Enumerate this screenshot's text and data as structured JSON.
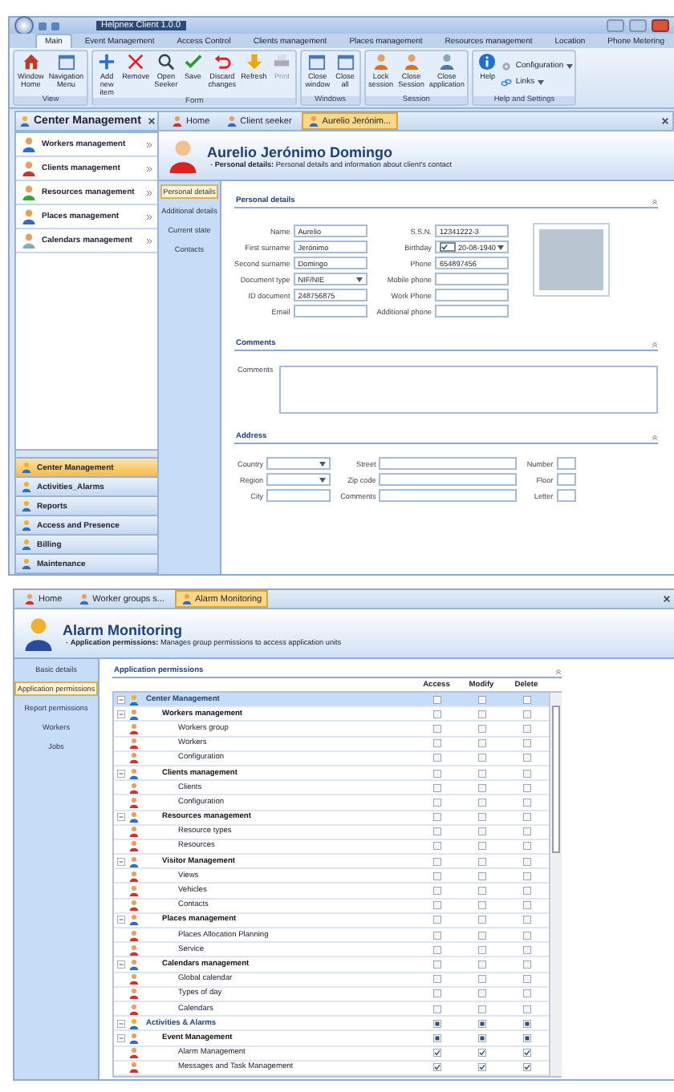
{
  "window": {
    "title": "Helpnex Client 1.0.0"
  },
  "menu_tabs": [
    {
      "label": "Main",
      "selected": true
    },
    {
      "label": "Event Management",
      "selected": false
    },
    {
      "label": "Access Control",
      "selected": false
    },
    {
      "label": "Clients management",
      "selected": false
    },
    {
      "label": "Places management",
      "selected": false
    },
    {
      "label": "Resources management",
      "selected": false
    },
    {
      "label": "Location",
      "selected": false
    },
    {
      "label": "Phone Metering",
      "selected": false
    }
  ],
  "ribbon": [
    {
      "group": "View",
      "buttons": [
        {
          "label": "Window Home",
          "kind": "large",
          "disabled": false
        },
        {
          "label": "Navigation Menu",
          "kind": "large",
          "disabled": false
        }
      ]
    },
    {
      "group": "Form",
      "buttons": [
        {
          "label": "Add new item",
          "kind": "large",
          "disabled": false
        },
        {
          "label": "Remove",
          "kind": "large",
          "disabled": false
        },
        {
          "label": "Open Seeker",
          "kind": "large",
          "disabled": false
        },
        {
          "label": "Save",
          "kind": "large",
          "disabled": false
        },
        {
          "label": "Discard changes",
          "kind": "large",
          "disabled": false
        },
        {
          "label": "Refresh",
          "kind": "large",
          "disabled": false
        },
        {
          "label": "Print",
          "kind": "large",
          "disabled": true
        }
      ]
    },
    {
      "group": "Windows",
      "buttons": [
        {
          "label": "Close window",
          "kind": "large",
          "disabled": false
        },
        {
          "label": "Close all",
          "kind": "large",
          "disabled": false
        }
      ]
    },
    {
      "group": "Session",
      "buttons": [
        {
          "label": "Lock session",
          "kind": "large",
          "disabled": false
        },
        {
          "label": "Close Session",
          "kind": "large",
          "disabled": false
        },
        {
          "label": "Close application",
          "kind": "large",
          "disabled": false
        }
      ]
    },
    {
      "group": "Help and Settings",
      "buttons": [
        {
          "label": "Help",
          "kind": "large",
          "disabled": false
        },
        {
          "label": "Configuration",
          "kind": "small",
          "disabled": false
        },
        {
          "label": "Links",
          "kind": "small",
          "disabled": false
        }
      ]
    }
  ],
  "sidebar": {
    "title": "Center Management",
    "modules": [
      "Workers management",
      "Clients management",
      "Resources management",
      "Places management",
      "Calendars management"
    ],
    "sections": [
      {
        "label": "Center Management",
        "selected": true
      },
      {
        "label": "Activities_Alarms",
        "selected": false
      },
      {
        "label": "Reports",
        "selected": false
      },
      {
        "label": "Access and Presence",
        "selected": false
      },
      {
        "label": "Billing",
        "selected": false
      },
      {
        "label": "Maintenance",
        "selected": false
      }
    ]
  },
  "documents": [
    {
      "label": "Home",
      "selected": false
    },
    {
      "label": "Client seeker",
      "selected": false
    },
    {
      "label": "Aurelio Jerónim...",
      "selected": true
    }
  ],
  "client": {
    "name": "Aurelio Jerónimo Domingo",
    "subtitle": "- **Personal details:** Personal details and information about client's contact",
    "side_tabs": [
      {
        "label": "Personal details",
        "selected": true
      },
      {
        "label": "Additional details",
        "selected": false
      },
      {
        "label": "Current state",
        "selected": false
      },
      {
        "label": "Contacts",
        "selected": false
      }
    ],
    "personal": {
      "title": "Personal details",
      "left": [
        {
          "label": "Name",
          "value": "Aurelio",
          "kind": "text"
        },
        {
          "label": "First surname",
          "value": "Jerónimo",
          "kind": "text"
        },
        {
          "label": "Second surname",
          "value": "Domingo",
          "kind": "text"
        },
        {
          "label": "Document type",
          "value": "NIF/NIE",
          "kind": "select"
        },
        {
          "label": "ID document",
          "value": "248756875",
          "kind": "text"
        },
        {
          "label": "Email",
          "kind": "text"
        }
      ],
      "right": [
        {
          "label": "S.S.N.",
          "value": "12341222-3",
          "kind": "text"
        },
        {
          "label": "Birthday",
          "value": "20-08-1940",
          "kind": "date",
          "checked": true
        },
        {
          "label": "Phone",
          "value": "654897456",
          "kind": "text"
        },
        {
          "label": "Mobile phone",
          "kind": "text"
        },
        {
          "label": "Work Phone",
          "kind": "text"
        },
        {
          "label": "Additional phone",
          "kind": "text"
        }
      ]
    },
    "comments": {
      "title": "Comments",
      "label": "Comments"
    },
    "address": {
      "title": "Address",
      "columns": [
        [
          {
            "label": "Country",
            "kind": "select"
          },
          {
            "label": "Region",
            "kind": "select"
          },
          {
            "label": "City",
            "kind": "text"
          }
        ],
        [
          {
            "label": "Street",
            "kind": "text"
          },
          {
            "label": "Zip code",
            "kind": "text"
          },
          {
            "label": "Comments",
            "kind": "text"
          }
        ],
        [
          {
            "label": "Number",
            "kind": "text"
          },
          {
            "label": "Floor",
            "kind": "text"
          },
          {
            "label": "Letter",
            "kind": "text"
          }
        ]
      ]
    }
  },
  "alarm": {
    "documents": [
      {
        "label": "Home",
        "selected": false
      },
      {
        "label": "Worker groups s...",
        "selected": false
      },
      {
        "label": "Alarm Monitoring",
        "selected": true
      }
    ],
    "title": "Alarm Monitoring",
    "subtitle": "- **Application permissions:** Manages group permissions to access application units",
    "side_tabs": [
      {
        "label": "Basic details",
        "selected": false
      },
      {
        "label": "Application permissions",
        "selected": true
      },
      {
        "label": "Report permissions",
        "selected": false
      },
      {
        "label": "Workers",
        "selected": false
      },
      {
        "label": "Jobs",
        "selected": false
      }
    ],
    "permissions": {
      "title": "Application permissions",
      "columns": [
        "Access",
        "Modify",
        "Delete"
      ],
      "rows": [
        {
          "label": "Center Management",
          "selected": true,
          "expanded": true,
          "cells": [
            {
              "checked": false,
              "indeterminate": false
            },
            {
              "checked": false,
              "indeterminate": false
            },
            {
              "checked": false,
              "indeterminate": false
            }
          ],
          "children": [
            {
              "label": "Workers management",
              "selected": false,
              "expanded": true,
              "cells": [
                {
                  "checked": false,
                  "indeterminate": false
                },
                {
                  "checked": false,
                  "indeterminate": false
                },
                {
                  "checked": false,
                  "indeterminate": false
                }
              ],
              "children": [
                {
                  "label": "Workers group",
                  "selected": false,
                  "cells": [
                    {
                      "checked": false,
                      "indeterminate": false
                    },
                    {
                      "checked": false,
                      "indeterminate": false
                    },
                    {
                      "checked": false,
                      "indeterminate": false
                    }
                  ]
                },
                {
                  "label": "Workers",
                  "selected": false,
                  "cells": [
                    {
                      "checked": false,
                      "indeterminate": false
                    },
                    {
                      "checked": false,
                      "indeterminate": false
                    },
                    {
                      "checked": false,
                      "indeterminate": false
                    }
                  ]
                },
                {
                  "label": "Configuration",
                  "selected": false,
                  "cells": [
                    {
                      "checked": false,
                      "indeterminate": false
                    },
                    {
                      "checked": false,
                      "indeterminate": false
                    },
                    {
                      "checked": false,
                      "indeterminate": false
                    }
                  ]
                }
              ]
            },
            {
              "label": "Clients management",
              "selected": false,
              "expanded": true,
              "cells": [
                {
                  "checked": false,
                  "indeterminate": false
                },
                {
                  "checked": false,
                  "indeterminate": false
                },
                {
                  "checked": false,
                  "indeterminate": false
                }
              ],
              "children": [
                {
                  "label": "Clients",
                  "selected": false,
                  "cells": [
                    {
                      "checked": false,
                      "indeterminate": false
                    },
                    {
                      "checked": false,
                      "indeterminate": false
                    },
                    {
                      "checked": false,
                      "indeterminate": false
                    }
                  ]
                },
                {
                  "label": "Configuration",
                  "selected": false,
                  "cells": [
                    {
                      "checked": false,
                      "indeterminate": false
                    },
                    {
                      "checked": false,
                      "indeterminate": false
                    },
                    {
                      "checked": false,
                      "indeterminate": false
                    }
                  ]
                }
              ]
            },
            {
              "label": "Resources management",
              "selected": false,
              "expanded": true,
              "cells": [
                {
                  "checked": false,
                  "indeterminate": false
                },
                {
                  "checked": false,
                  "indeterminate": false
                },
                {
                  "checked": false,
                  "indeterminate": false
                }
              ],
              "children": [
                {
                  "label": "Resource types",
                  "selected": false,
                  "cells": [
                    {
                      "checked": false,
                      "indeterminate": false
                    },
                    {
                      "checked": false,
                      "indeterminate": false
                    },
                    {
                      "checked": false,
                      "indeterminate": false
                    }
                  ]
                },
                {
                  "label": "Resources",
                  "selected": false,
                  "cells": [
                    {
                      "checked": false,
                      "indeterminate": false
                    },
                    {
                      "checked": false,
                      "indeterminate": false
                    },
                    {
                      "checked": false,
                      "indeterminate": false
                    }
                  ]
                }
              ]
            },
            {
              "label": "Visitor Management",
              "selected": false,
              "expanded": true,
              "cells": [
                {
                  "checked": false,
                  "indeterminate": false
                },
                {
                  "checked": false,
                  "indeterminate": false
                },
                {
                  "checked": false,
                  "indeterminate": false
                }
              ],
              "children": [
                {
                  "label": "Views",
                  "selected": false,
                  "cells": [
                    {
                      "checked": false,
                      "indeterminate": false
                    },
                    {
                      "checked": false,
                      "indeterminate": false
                    },
                    {
                      "checked": false,
                      "indeterminate": false
                    }
                  ]
                },
                {
                  "label": "Vehicles",
                  "selected": false,
                  "cells": [
                    {
                      "checked": false,
                      "indeterminate": false
                    },
                    {
                      "checked": false,
                      "indeterminate": false
                    },
                    {
                      "checked": false,
                      "indeterminate": false
                    }
                  ]
                },
                {
                  "label": "Contacts",
                  "selected": false,
                  "cells": [
                    {
                      "checked": false,
                      "indeterminate": false
                    },
                    {
                      "checked": false,
                      "indeterminate": false
                    },
                    {
                      "checked": false,
                      "indeterminate": false
                    }
                  ]
                }
              ]
            },
            {
              "label": "Places management",
              "selected": false,
              "expanded": true,
              "cells": [
                {
                  "checked": false,
                  "indeterminate": false
                },
                {
                  "checked": false,
                  "indeterminate": false
                },
                {
                  "checked": false,
                  "indeterminate": false
                }
              ],
              "children": [
                {
                  "label": "Places Allocation Planning",
                  "selected": false,
                  "cells": [
                    {
                      "checked": false,
                      "indeterminate": false
                    },
                    {
                      "checked": false,
                      "indeterminate": false
                    },
                    {
                      "checked": false,
                      "indeterminate": false
                    }
                  ]
                },
                {
                  "label": "Service",
                  "selected": false,
                  "cells": [
                    {
                      "checked": false,
                      "indeterminate": false
                    },
                    {
                      "checked": false,
                      "indeterminate": false
                    },
                    {
                      "checked": false,
                      "indeterminate": false
                    }
                  ]
                }
              ]
            },
            {
              "label": "Calendars management",
              "selected": false,
              "expanded": true,
              "cells": [
                {
                  "checked": false,
                  "indeterminate": false
                },
                {
                  "checked": false,
                  "indeterminate": false
                },
                {
                  "checked": false,
                  "indeterminate": false
                }
              ],
              "children": [
                {
                  "label": "Global calendar",
                  "selected": false,
                  "cells": [
                    {
                      "checked": false,
                      "indeterminate": false
                    },
                    {
                      "checked": false,
                      "indeterminate": false
                    },
                    {
                      "checked": false,
                      "indeterminate": false
                    }
                  ]
                },
                {
                  "label": "Types of day",
                  "selected": false,
                  "cells": [
                    {
                      "checked": false,
                      "indeterminate": false
                    },
                    {
                      "checked": false,
                      "indeterminate": false
                    },
                    {
                      "checked": false,
                      "indeterminate": false
                    }
                  ]
                },
                {
                  "label": "Calendars",
                  "selected": false,
                  "cells": [
                    {
                      "checked": false,
                      "indeterminate": false
                    },
                    {
                      "checked": false,
                      "indeterminate": false
                    },
                    {
                      "checked": false,
                      "indeterminate": false
                    }
                  ]
                }
              ]
            }
          ]
        },
        {
          "label": "Activities & Alarms",
          "selected": false,
          "expanded": true,
          "cells": [
            {
              "checked": false,
              "indeterminate": true
            },
            {
              "checked": false,
              "indeterminate": true
            },
            {
              "checked": false,
              "indeterminate": true
            }
          ],
          "children": [
            {
              "label": "Event Management",
              "selected": false,
              "expanded": true,
              "cells": [
                {
                  "checked": false,
                  "indeterminate": true
                },
                {
                  "checked": false,
                  "indeterminate": true
                },
                {
                  "checked": false,
                  "indeterminate": true
                }
              ],
              "children": [
                {
                  "label": "Alarm Management",
                  "selected": false,
                  "cells": [
                    {
                      "checked": true,
                      "indeterminate": false
                    },
                    {
                      "checked": true,
                      "indeterminate": false
                    },
                    {
                      "checked": true,
                      "indeterminate": false
                    }
                  ]
                },
                {
                  "label": "Messages and Task Management",
                  "selected": false,
                  "cells": [
                    {
                      "checked": true,
                      "indeterminate": false
                    },
                    {
                      "checked": true,
                      "indeterminate": false
                    },
                    {
                      "checked": true,
                      "indeterminate": false
                    }
                  ]
                }
              ]
            }
          ]
        }
      ]
    }
  }
}
